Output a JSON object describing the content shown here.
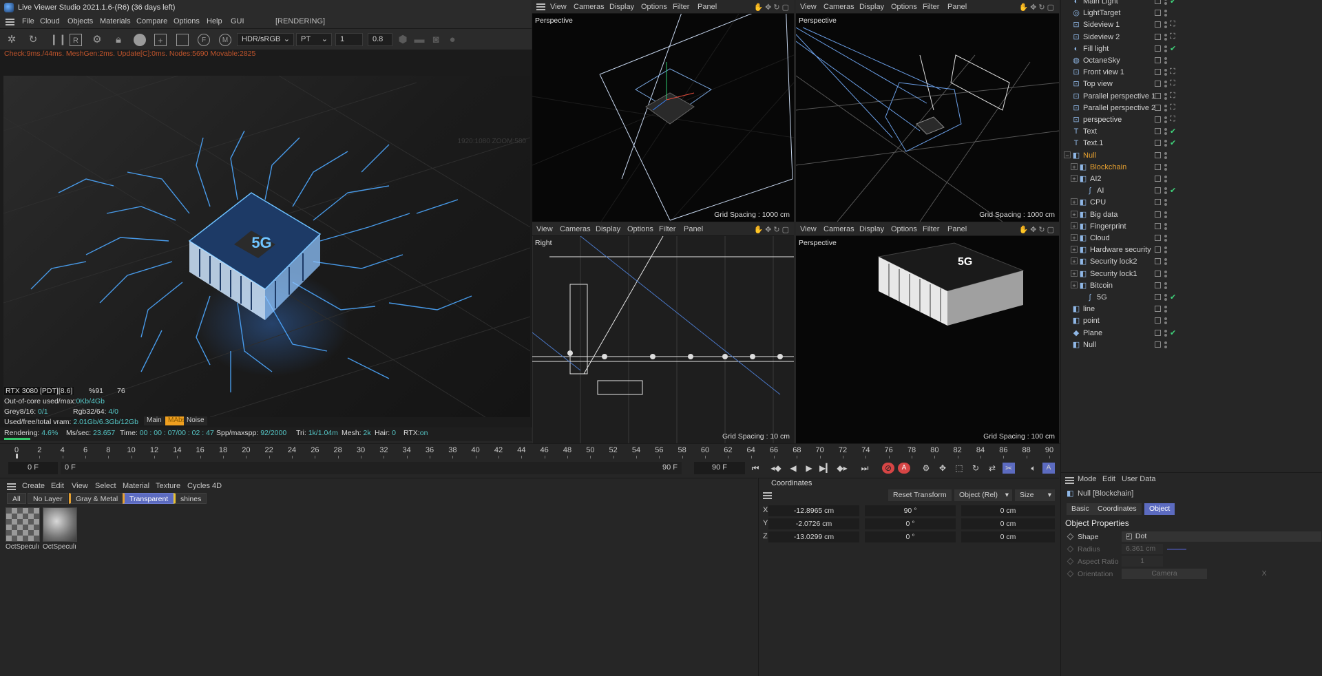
{
  "live_viewer": {
    "title": "Live Viewer Studio 2021.1.6-(R6) (36 days left)",
    "menu": [
      "File",
      "Cloud",
      "Objects",
      "Materials",
      "Compare",
      "Options",
      "Help",
      "GUI"
    ],
    "render_state": "[RENDERING]",
    "toolbar": {
      "color_space": "HDR/sRGB",
      "kernel": "PT",
      "value1": "1",
      "value2": "0.8"
    },
    "status_line": "Check:9ms./44ms. MeshGen:2ms. Update[C]:0ms. Nodes:5690 Movable:2825",
    "zoom_info": "1920:1080 ZOOM:580",
    "chip_label": "5G",
    "stats": {
      "gpu": "RTX 3080 [PDT][8.6]",
      "gpu_pct": "%91",
      "gpu_temp": "76",
      "out_of_core_label": "Out-of-core used/max:",
      "out_of_core_value": "0Kb/4Gb",
      "grey_label": "Grey8/16:",
      "grey_value": "0/1",
      "rgb_label": "Rgb32/64:",
      "rgb_value": "4/0",
      "vram_label": "Used/free/total vram:",
      "vram_value": "2.01Gb/6.3Gb/12Gb"
    },
    "tabs": [
      "Main",
      "MAbs",
      "Noise"
    ],
    "bottom": {
      "rendering_label": "Rendering:",
      "rendering_value": "4.6%",
      "ms_label": "Ms/sec:",
      "ms_value": "23.657",
      "time_label": "Time:",
      "time_value": "00 : 00 : 07/00 : 02 : 47",
      "spp_label": "Spp/maxspp:",
      "spp_value": "92/2000",
      "tri_label": "Tri:",
      "tri_value": "1k/1.04m",
      "mesh_label": "Mesh:",
      "mesh_value": "2k",
      "hair_label": "Hair:",
      "hair_value": "0",
      "rtx_label": "RTX:",
      "rtx_value": "on"
    },
    "progress_fraction": 0.046
  },
  "viewports": {
    "menu": [
      "View",
      "Cameras",
      "Display",
      "Options",
      "Filter",
      "Panel"
    ],
    "nav_icons": [
      "hand-icon",
      "move-icon",
      "rotate-icon",
      "maximize-icon"
    ],
    "top_left": {
      "name": "Perspective",
      "grid": "Grid Spacing : 1000 cm"
    },
    "top_right": {
      "name": "Perspective",
      "grid": "Grid Spacing : 1000 cm"
    },
    "bottom_left": {
      "name": "Right",
      "grid": "Grid Spacing : 10 cm"
    },
    "bottom_right": {
      "name": "Perspective",
      "grid": "Grid Spacing : 100 cm",
      "label": "5G"
    }
  },
  "timeline": {
    "ticks": [
      "0",
      "2",
      "4",
      "6",
      "8",
      "10",
      "12",
      "14",
      "16",
      "18",
      "20",
      "22",
      "24",
      "26",
      "28",
      "30",
      "32",
      "34",
      "36",
      "38",
      "40",
      "42",
      "44",
      "46",
      "48",
      "50",
      "52",
      "54",
      "56",
      "58",
      "60",
      "62",
      "64",
      "66",
      "68",
      "70",
      "72",
      "74",
      "76",
      "78",
      "80",
      "82",
      "84",
      "86",
      "88",
      "90"
    ],
    "current_frame": "0 F",
    "start_frame": "0 F",
    "end_frame_a": "90 F",
    "end_frame_b": "90 F"
  },
  "materials": {
    "menu": [
      "Create",
      "Edit",
      "View",
      "Select",
      "Material",
      "Texture",
      "Cycles 4D"
    ],
    "filters": [
      "All",
      "No Layer",
      "Gray & Metal",
      "Transparent",
      "shines"
    ],
    "active_filter": "Transparent",
    "items": [
      "OctSpeculı",
      "OctSpeculı"
    ]
  },
  "coordinates": {
    "title": "Coordinates",
    "reset": "Reset Transform",
    "mode": "Object (Rel)",
    "size_mode": "Size",
    "rows": [
      {
        "axis": "X",
        "pos": "-12.8965 cm",
        "rot": "90 °",
        "size": "0 cm"
      },
      {
        "axis": "Y",
        "pos": "-2.0726 cm",
        "rot": "0 °",
        "size": "0 cm"
      },
      {
        "axis": "Z",
        "pos": "-13.0299 cm",
        "rot": "0 °",
        "size": "0 cm"
      }
    ]
  },
  "objects": [
    {
      "name": "Main Light",
      "icon": "light-icon",
      "indent": 0
    },
    {
      "name": "LightTarget",
      "icon": "target-icon",
      "indent": 0
    },
    {
      "name": "Sideview 1",
      "icon": "camera-icon",
      "indent": 0
    },
    {
      "name": "Sideview 2",
      "icon": "camera-icon",
      "indent": 0
    },
    {
      "name": "Fill light",
      "icon": "light-icon",
      "indent": 0
    },
    {
      "name": "OctaneSky",
      "icon": "sky-icon",
      "indent": 0
    },
    {
      "name": "Front view 1",
      "icon": "camera-icon",
      "indent": 0
    },
    {
      "name": "Top view",
      "icon": "camera-icon",
      "indent": 0
    },
    {
      "name": "Parallel perspective 1",
      "icon": "camera-icon",
      "indent": 0
    },
    {
      "name": "Parallel perspective 2",
      "icon": "camera-icon",
      "indent": 0
    },
    {
      "name": "perspective",
      "icon": "camera-icon",
      "indent": 0
    },
    {
      "name": "Text",
      "icon": "text-icon",
      "indent": 0
    },
    {
      "name": "Text.1",
      "icon": "text-icon",
      "indent": 0
    },
    {
      "name": "Null",
      "icon": "null-icon",
      "indent": 0,
      "orange": true
    },
    {
      "name": "Blockchain",
      "icon": "null-icon",
      "indent": 1,
      "orange": true
    },
    {
      "name": "AI2",
      "icon": "null-icon",
      "indent": 1
    },
    {
      "name": "AI",
      "icon": "spline-icon",
      "indent": 2
    },
    {
      "name": "CPU",
      "icon": "null-icon",
      "indent": 1
    },
    {
      "name": "Big data",
      "icon": "null-icon",
      "indent": 1
    },
    {
      "name": "Fingerprint",
      "icon": "null-icon",
      "indent": 1
    },
    {
      "name": "Cloud",
      "icon": "null-icon",
      "indent": 1
    },
    {
      "name": "Hardware security",
      "icon": "null-icon",
      "indent": 1
    },
    {
      "name": "Security lock2",
      "icon": "null-icon",
      "indent": 1
    },
    {
      "name": "Security lock1",
      "icon": "null-icon",
      "indent": 1
    },
    {
      "name": "Bitcoin",
      "icon": "null-icon",
      "indent": 1
    },
    {
      "name": "5G",
      "icon": "spline-icon",
      "indent": 2
    },
    {
      "name": "line",
      "icon": "null-icon",
      "indent": 0
    },
    {
      "name": "point",
      "icon": "null-icon",
      "indent": 0
    },
    {
      "name": "Plane",
      "icon": "plane-icon",
      "indent": 0
    },
    {
      "name": "Null",
      "icon": "null-icon",
      "indent": 0
    }
  ],
  "attributes": {
    "menu": [
      "Mode",
      "Edit",
      "User Data"
    ],
    "object_title": "Null [Blockchain]",
    "tabs": [
      "Basic",
      "Coordinates",
      "Object"
    ],
    "active_tab": "Object",
    "section": "Object Properties",
    "shape_label": "Shape",
    "shape_value": "Dot",
    "radius_label": "Radius",
    "radius_value": "6.361 cm",
    "aspect_label": "Aspect Ratio",
    "aspect_value": "1",
    "orientation_label": "Orientation",
    "orientation_value": "Camera",
    "orientation_axis": "X"
  },
  "colors": {
    "accent": "#5c6bc0",
    "green": "#3fd17a",
    "orange": "#e6a030",
    "cyan": "#55c6c6",
    "glow": "#3c8cff"
  }
}
